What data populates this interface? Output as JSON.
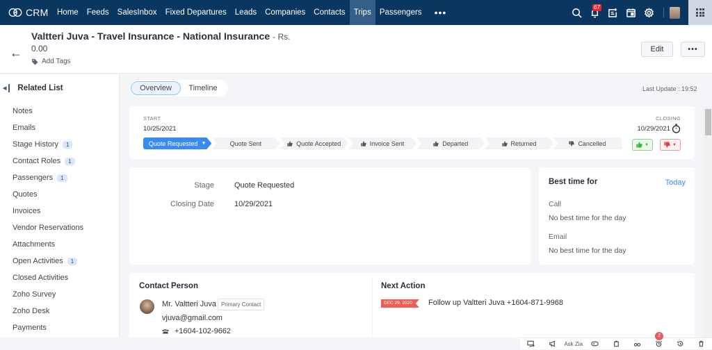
{
  "topnav": {
    "brand": "CRM",
    "items": [
      {
        "label": "Home",
        "active": false
      },
      {
        "label": "Feeds",
        "active": false
      },
      {
        "label": "SalesInbox",
        "active": false
      },
      {
        "label": "Fixed Departures",
        "active": false
      },
      {
        "label": "Leads",
        "active": false
      },
      {
        "label": "Companies",
        "active": false
      },
      {
        "label": "Contacts",
        "active": false
      },
      {
        "label": "Trips",
        "active": true
      },
      {
        "label": "Passengers",
        "active": false
      }
    ],
    "more_label": "•••",
    "notification_count": "67",
    "icons": [
      "search-icon",
      "bell-icon",
      "add-note-icon",
      "calendar-icon",
      "gear-icon",
      "avatar",
      "apps-grid-icon"
    ]
  },
  "header": {
    "title": "Valtteri Juva - Travel Insurance - National Insurance",
    "currency_sep": "- Rs.",
    "amount": "0.00",
    "add_tags": "Add Tags",
    "edit_label": "Edit",
    "more_label": "•••"
  },
  "sidebar": {
    "heading": "Related List",
    "items": [
      {
        "label": "Notes",
        "count": null
      },
      {
        "label": "Emails",
        "count": null
      },
      {
        "label": "Stage History",
        "count": "1"
      },
      {
        "label": "Contact Roles",
        "count": "1"
      },
      {
        "label": "Passengers",
        "count": "1"
      },
      {
        "label": "Quotes",
        "count": null
      },
      {
        "label": "Invoices",
        "count": null
      },
      {
        "label": "Vendor Reservations",
        "count": null
      },
      {
        "label": "Attachments",
        "count": null
      },
      {
        "label": "Open Activities",
        "count": "1"
      },
      {
        "label": "Closed Activities",
        "count": null
      },
      {
        "label": "Zoho Survey",
        "count": null
      },
      {
        "label": "Zoho Desk",
        "count": null
      },
      {
        "label": "Payments",
        "count": null
      }
    ]
  },
  "tabs": [
    {
      "label": "Overview",
      "active": true
    },
    {
      "label": "Timeline",
      "active": false
    }
  ],
  "last_update": "Last Update : 19:52",
  "stage": {
    "start_label": "START",
    "start_date": "10/25/2021",
    "closing_label": "CLOSING",
    "closing_date": "10/29/2021",
    "pipeline": [
      {
        "label": "Quote Requested",
        "icon": null,
        "active": true
      },
      {
        "label": "Quote Sent",
        "icon": null,
        "active": false
      },
      {
        "label": "Quote Accepted",
        "icon": "thumbs-up",
        "active": false
      },
      {
        "label": "Invoice Sent",
        "icon": "thumbs-up",
        "active": false
      },
      {
        "label": "Departed",
        "icon": "thumbs-up",
        "active": false
      },
      {
        "label": "Returned",
        "icon": "thumbs-up",
        "active": false
      },
      {
        "label": "Cancelled",
        "icon": "thumbs-down",
        "active": false
      }
    ],
    "colors": {
      "active": "#3a8bf0",
      "won": "#3bb13b",
      "lost": "#e53935"
    }
  },
  "details": {
    "fields": [
      {
        "label": "Stage",
        "value": "Quote Requested"
      },
      {
        "label": "Closing Date",
        "value": "10/29/2021"
      }
    ]
  },
  "best_time": {
    "title": "Best time for",
    "period": "Today",
    "call_label": "Call",
    "call_value": "No best time for the day",
    "email_label": "Email",
    "email_value": "No best time for the day"
  },
  "contact_person": {
    "heading": "Contact Person",
    "name": "Mr. Valtteri Juva",
    "role_badge": "Primary Contact",
    "email": "vjuva@gmail.com",
    "phone": "+1604-102-9662"
  },
  "next_action": {
    "heading": "Next Action",
    "date": "DEC 29, 2020",
    "text": "Follow up Valtteri Juva +1604-871-9968"
  },
  "footer": {
    "ask_zia": "Ask Zia",
    "reminder_count": "2"
  }
}
